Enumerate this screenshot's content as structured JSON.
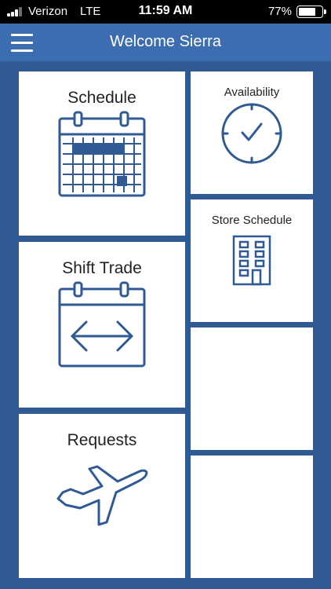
{
  "status_bar": {
    "carrier": "Verizon",
    "network": "LTE",
    "time": "11:59 AM",
    "battery_percent": "77%",
    "battery_level": 0.77
  },
  "header": {
    "title": "Welcome Sierra",
    "menu_icon": "hamburger-menu-icon"
  },
  "tiles": [
    {
      "label": "Schedule",
      "icon": "calendar-grid-icon"
    },
    {
      "label": "Shift Trade",
      "icon": "calendar-arrows-icon"
    },
    {
      "label": "Requests",
      "icon": "airplane-icon"
    },
    {
      "label": "Availability",
      "icon": "clock-check-icon"
    },
    {
      "label": "Store Schedule",
      "icon": "building-icon"
    },
    {
      "label": ""
    },
    {
      "label": ""
    }
  ],
  "colors": {
    "background": "#2f5a94",
    "header": "#3b6db0",
    "icon": "#2f5a94",
    "tile": "#ffffff"
  }
}
